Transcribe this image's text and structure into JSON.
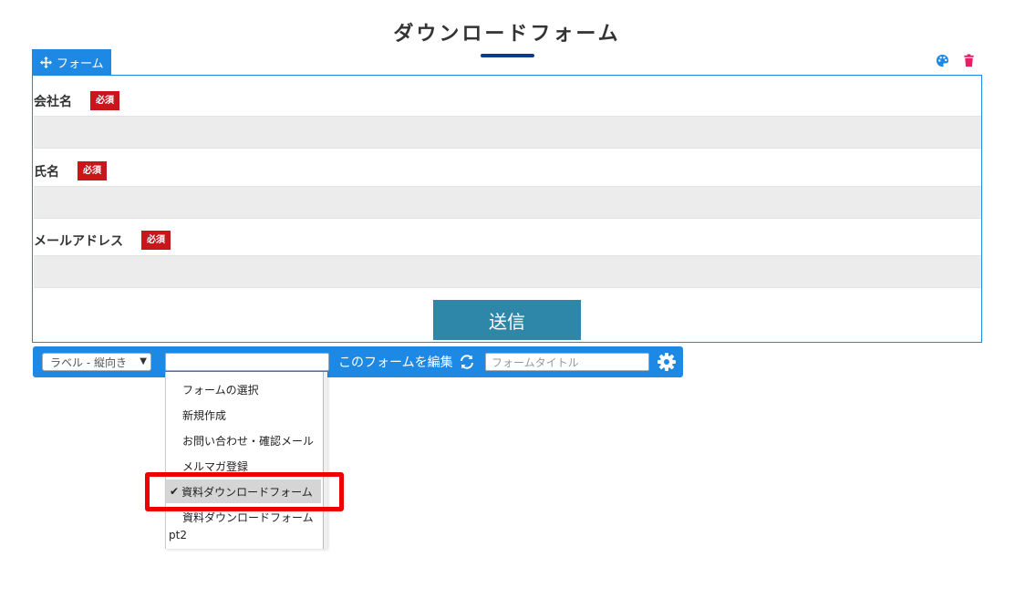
{
  "page": {
    "title": "ダウンロードフォーム"
  },
  "form_tab": {
    "label": "フォーム",
    "icon": "move-icon"
  },
  "top_icons": {
    "palette": "palette-icon",
    "trash": "trash-icon"
  },
  "fields": [
    {
      "label": "会社名",
      "required": "必須",
      "value": ""
    },
    {
      "label": "氏名",
      "required": "必須",
      "value": ""
    },
    {
      "label": "メールアドレス",
      "required": "必須",
      "value": ""
    }
  ],
  "submit": {
    "label": "送信"
  },
  "toolbar": {
    "layout_select": "ラベル - 縦向き",
    "form_select_value": "",
    "edit_label": "このフォームを編集",
    "title_placeholder": "フォームタイトル"
  },
  "dropdown": {
    "items": [
      {
        "label": "フォームの選択"
      },
      {
        "label": "新規作成"
      },
      {
        "label": "お問い合わせ・確認メール"
      },
      {
        "label": "メルマガ登録"
      },
      {
        "label": "資料ダウンロードフォーム",
        "selected": true
      },
      {
        "label": "資料ダウンロードフォーム",
        "continuation": "pt2"
      }
    ]
  },
  "colors": {
    "accent": "#1e88e5",
    "required_badge": "#c8161d",
    "submit": "#2e86a8",
    "title_underline": "#0d3b8c",
    "highlight": "#ee0000"
  }
}
